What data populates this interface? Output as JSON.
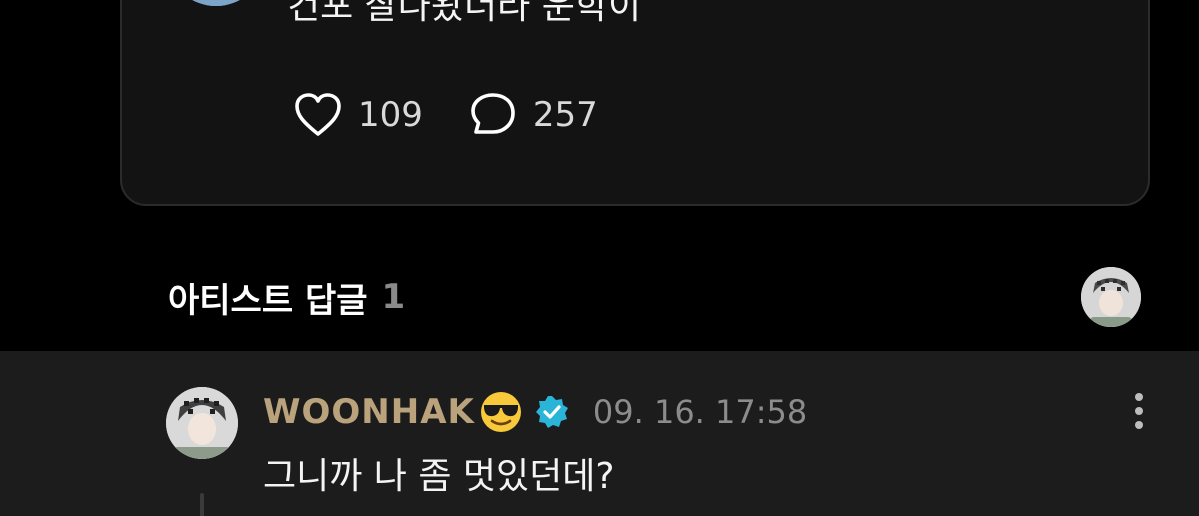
{
  "post": {
    "text": "컨포 잘나왔더라 운학이",
    "like_count": "109",
    "comment_count": "257",
    "icons": {
      "like": "heart-outline-icon",
      "comment": "chat-bubble-outline-icon"
    }
  },
  "artist_replies": {
    "title": "아티스트 답글",
    "count": "1"
  },
  "reply": {
    "author": "WOONHAK",
    "author_emoji": "sunglasses-face-emoji",
    "verified": true,
    "timestamp": "09. 16. 17:58",
    "text": "그니까 나 좀 멋있던데?",
    "menu_icon": "more-vertical-icon"
  },
  "colors": {
    "background": "#000000",
    "card": "#131313",
    "reply_background": "#1c1c1c",
    "author_name": "#b9a27c",
    "verified_badge": "#2ab4d8",
    "muted_text": "#8c8c8c"
  }
}
